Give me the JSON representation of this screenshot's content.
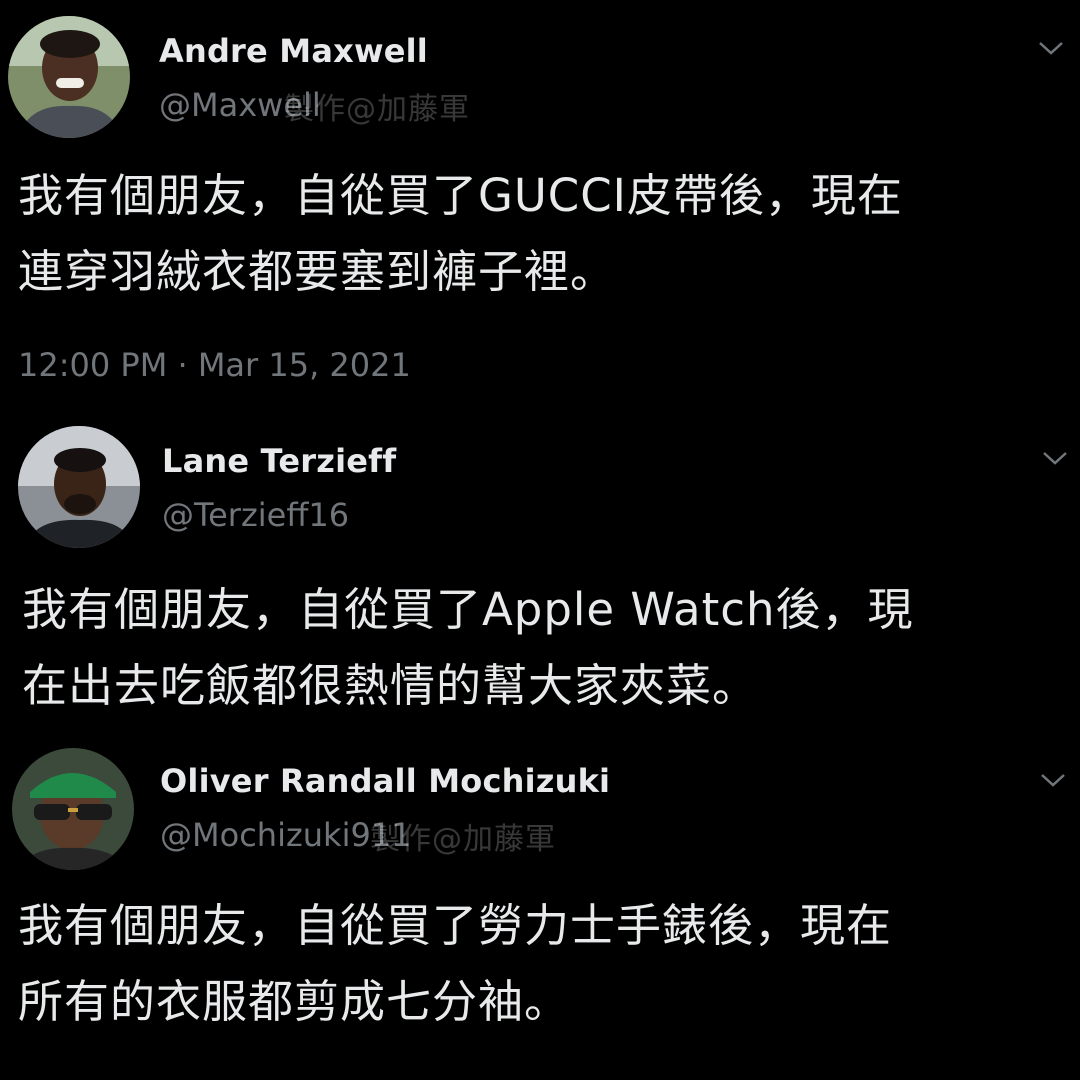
{
  "tweets": [
    {
      "name": "Andre Maxwell",
      "handle": "@Maxwell",
      "text": "我有個朋友，自從買了GUCCI皮帶後，現在\n連穿羽絨衣都要塞到褲子裡。",
      "timestamp": "12:00 PM · Mar 15, 2021",
      "watermark": "製作@加藤軍",
      "menu_icon": "chevron-down-icon"
    },
    {
      "name": "Lane Terzieff",
      "handle": "@Terzieff16",
      "text": "我有個朋友，自從買了Apple Watch後，現\n在出去吃飯都很熱情的幫大家夾菜。",
      "menu_icon": "chevron-down-icon"
    },
    {
      "name": "Oliver Randall Mochizuki",
      "handle": "@Mochizuki911",
      "text": "我有個朋友，自從買了勞力士手錶後，現在\n所有的衣服都剪成七分袖。",
      "watermark": "製作@加藤軍",
      "menu_icon": "chevron-down-icon"
    }
  ],
  "colors": {
    "background": "#000000",
    "primary_text": "#e7e9ea",
    "secondary_text": "#71767b"
  }
}
